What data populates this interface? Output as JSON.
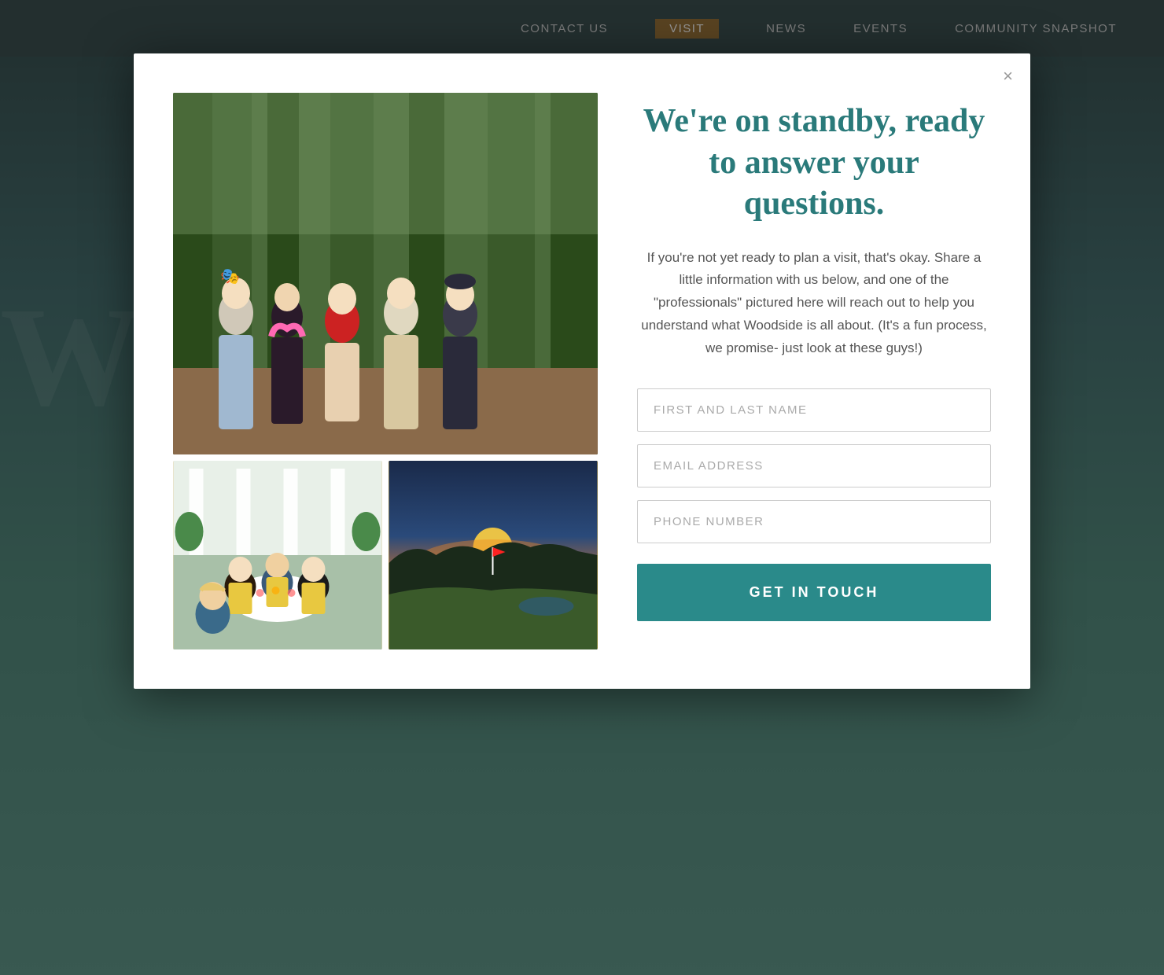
{
  "nav": {
    "items": [
      {
        "label": "CONTACT US",
        "active": false
      },
      {
        "label": "VISIT",
        "active": true
      },
      {
        "label": "NEWS",
        "active": false
      },
      {
        "label": "EVENTS",
        "active": false
      },
      {
        "label": "COMMUNITY SNAPSHOT",
        "active": false
      }
    ]
  },
  "modal": {
    "close_label": "×",
    "headline": "We're on standby, ready to answer your questions.",
    "body_text": "If you're not yet ready to plan a visit, that's okay. Share a little information with us below, and one of the \"professionals\" pictured here will reach out to help you understand what Woodside is all about. (It's a fun process, we promise- just look at these guys!)",
    "form": {
      "name_placeholder": "FIRST AND LAST NAME",
      "email_placeholder": "EMAIL ADDRESS",
      "phone_placeholder": "PHONE NUMBER"
    },
    "submit_label": "GET IN TOUCH"
  },
  "bg_text": "W",
  "colors": {
    "teal": "#2a8a8a",
    "nav_bg": "rgba(30,55,55,0.92)",
    "active_nav": "#8B5E1A"
  }
}
